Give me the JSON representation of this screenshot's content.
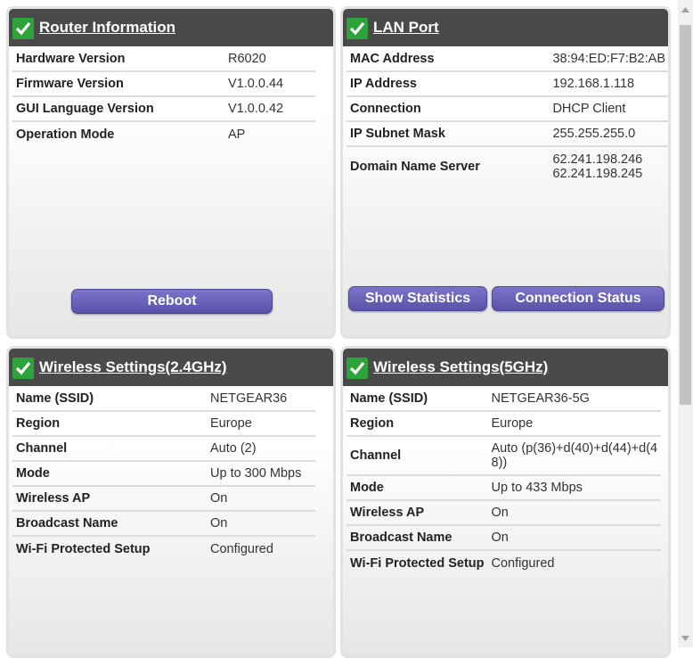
{
  "router_info": {
    "title": "Router Information",
    "rows": [
      {
        "label": "Hardware Version",
        "value": "R6020"
      },
      {
        "label": "Firmware Version",
        "value": "V1.0.0.44"
      },
      {
        "label": "GUI Language Version",
        "value": "V1.0.0.42"
      },
      {
        "label": "Operation Mode",
        "value": "AP"
      }
    ],
    "reboot_label": "Reboot"
  },
  "lan_port": {
    "title": "LAN Port",
    "rows": [
      {
        "label": "MAC Address",
        "value": "38:94:ED:F7:B2:AB"
      },
      {
        "label": "IP Address",
        "value": "192.168.1.118"
      },
      {
        "label": "Connection",
        "value": "DHCP Client"
      },
      {
        "label": "IP Subnet Mask",
        "value": "255.255.255.0"
      },
      {
        "label": "Domain Name Server",
        "value": "62.241.198.246",
        "value2": "62.241.198.245"
      }
    ],
    "show_statistics_label": "Show Statistics",
    "connection_status_label": "Connection Status"
  },
  "wireless_24": {
    "title": "Wireless Settings(2.4GHz)",
    "rows": [
      {
        "label": "Name (SSID)",
        "value": "NETGEAR36"
      },
      {
        "label": "Region",
        "value": "Europe"
      },
      {
        "label": "Channel",
        "value": "Auto (2)"
      },
      {
        "label": "Mode",
        "value": "Up to 300 Mbps"
      },
      {
        "label": "Wireless AP",
        "value": "On"
      },
      {
        "label": "Broadcast Name",
        "value": "On"
      },
      {
        "label": "Wi-Fi Protected Setup",
        "value": "Configured"
      }
    ]
  },
  "wireless_5": {
    "title": "Wireless Settings(5GHz)",
    "rows": [
      {
        "label": "Name (SSID)",
        "value": "NETGEAR36-5G"
      },
      {
        "label": "Region",
        "value": "Europe"
      },
      {
        "label": "Channel",
        "value": "Auto (p(36)+d(40)+d(44)+d(4",
        "value2": "8))"
      },
      {
        "label": "Mode",
        "value": "Up to 433 Mbps"
      },
      {
        "label": "Wireless AP",
        "value": "On"
      },
      {
        "label": "Broadcast Name",
        "value": "On"
      },
      {
        "label": "Wi-Fi Protected Setup",
        "value": "Configured"
      }
    ]
  },
  "colors": {
    "header_bg": "#4a4a4a",
    "check_green": "#2ea33b",
    "button_purple": "#5a52a8"
  }
}
